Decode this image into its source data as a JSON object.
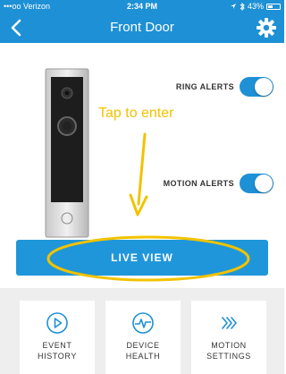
{
  "status_bar": {
    "carrier": "•••oo Verizon",
    "time": "2:34 PM",
    "battery": "43%",
    "battery_level": 0.43
  },
  "nav": {
    "title": "Front Door",
    "back_icon": "chevron-left-icon",
    "settings_icon": "gear-icon"
  },
  "toggles": [
    {
      "label": "RING ALERTS",
      "on": true
    },
    {
      "label": "MOTION ALERTS",
      "on": true
    }
  ],
  "annotation": {
    "text": "Tap to enter",
    "color": "#f2c200"
  },
  "live_view": {
    "label": "LIVE VIEW"
  },
  "tiles": [
    {
      "line1": "EVENT",
      "line2": "HISTORY",
      "icon": "play-circle-icon"
    },
    {
      "line1": "DEVICE",
      "line2": "HEALTH",
      "icon": "pulse-icon"
    },
    {
      "line1": "MOTION",
      "line2": "SETTINGS",
      "icon": "motion-waves-icon"
    }
  ],
  "colors": {
    "accent": "#1e90d6",
    "button": "#2096da",
    "background": "#ffffff",
    "tray": "#eeeeee"
  }
}
